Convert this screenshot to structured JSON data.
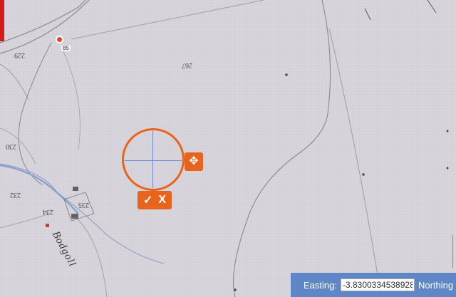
{
  "map": {
    "pin_label": "85",
    "parcel_numbers": [
      "229",
      "267",
      "230",
      "232",
      "234",
      "235"
    ],
    "place_name": "Bodgoll"
  },
  "marker": {
    "move_icon": "✥",
    "confirm_icon": "✓",
    "cancel_icon": "X"
  },
  "coords": {
    "easting_label": "Easting:",
    "easting_value": "-3.8300334538928",
    "northing_label": "Northing"
  },
  "colors": {
    "accent": "#e8631c",
    "panel": "#5f87c7",
    "map_paper": "#d9d5dc",
    "pin": "#e2432f"
  }
}
